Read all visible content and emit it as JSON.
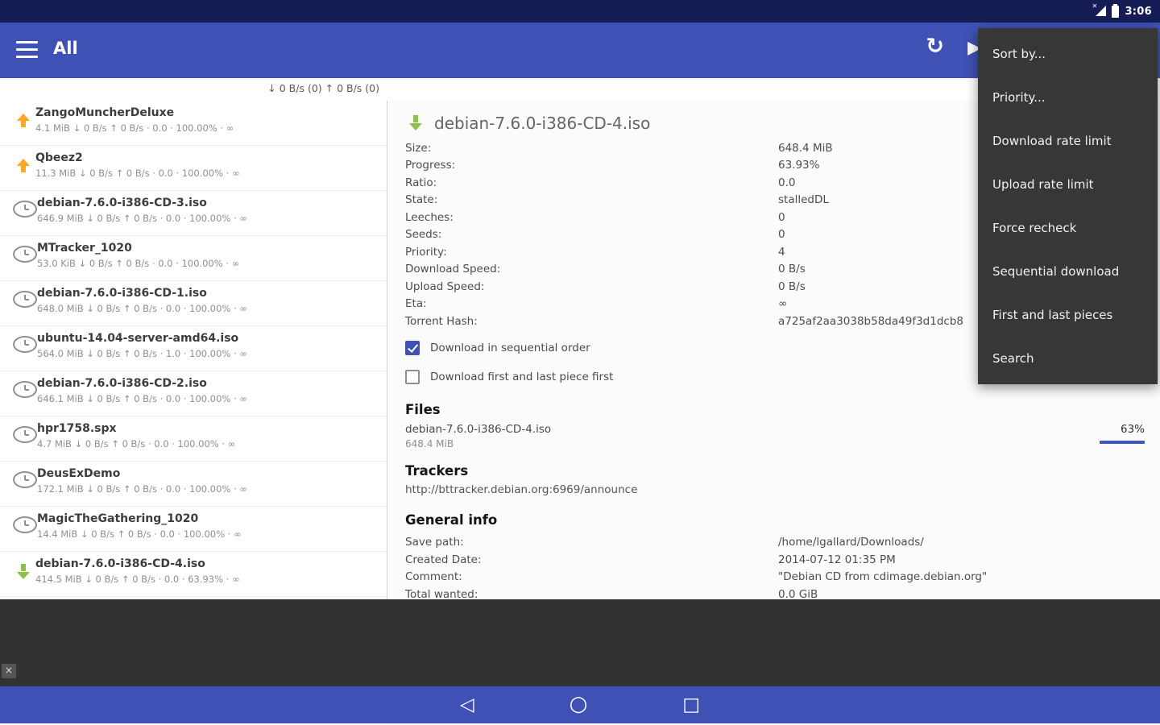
{
  "colors": {
    "primary": "#3F51B5",
    "accent_green": "#8BC34A",
    "accent_orange": "#FFA726"
  },
  "status_bar": {
    "time": "3:06"
  },
  "toolbar": {
    "title": "All"
  },
  "icons": {
    "refresh": "↻",
    "play": "▶",
    "close": "×",
    "nav_back": "◁",
    "nav_home": "○",
    "nav_recents": "□"
  },
  "speed_bar": {
    "text": "↓ 0 B/s (0)  ↑ 0 B/s (0)"
  },
  "menu": {
    "items": [
      "Sort by...",
      "Priority...",
      "Download rate limit",
      "Upload rate limit",
      "Force recheck",
      "Sequential download",
      "First and last pieces",
      "Search"
    ]
  },
  "torrents": [
    {
      "name": "ZangoMuncherDeluxe",
      "stats": "4.1 MiB ↓ 0 B/s ↑ 0 B/s · 0.0 · 100.00% · ∞",
      "icon": "upload"
    },
    {
      "name": "Qbeez2",
      "stats": "11.3 MiB ↓ 0 B/s ↑ 0 B/s · 0.0 · 100.00% · ∞",
      "icon": "upload"
    },
    {
      "name": "debian-7.6.0-i386-CD-3.iso",
      "stats": "646.9 MiB ↓ 0 B/s ↑ 0 B/s · 0.0 · 100.00% · ∞",
      "icon": "clock"
    },
    {
      "name": "MTracker_1020",
      "stats": "53.0 KiB ↓ 0 B/s ↑ 0 B/s · 0.0 · 100.00% · ∞",
      "icon": "clock"
    },
    {
      "name": "debian-7.6.0-i386-CD-1.iso",
      "stats": "648.0 MiB ↓ 0 B/s ↑ 0 B/s · 0.0 · 100.00% · ∞",
      "icon": "clock"
    },
    {
      "name": "ubuntu-14.04-server-amd64.iso",
      "stats": "564.0 MiB ↓ 0 B/s ↑ 0 B/s · 1.0 · 100.00% · ∞",
      "icon": "clock"
    },
    {
      "name": "debian-7.6.0-i386-CD-2.iso",
      "stats": "646.1 MiB ↓ 0 B/s ↑ 0 B/s · 0.0 · 100.00% · ∞",
      "icon": "clock"
    },
    {
      "name": "hpr1758.spx",
      "stats": "4.7 MiB ↓ 0 B/s ↑ 0 B/s · 0.0 · 100.00% · ∞",
      "icon": "clock"
    },
    {
      "name": "DeusExDemo",
      "stats": "172.1 MiB ↓ 0 B/s ↑ 0 B/s · 0.0 · 100.00% · ∞",
      "icon": "clock"
    },
    {
      "name": "MagicTheGathering_1020",
      "stats": "14.4 MiB ↓ 0 B/s ↑ 0 B/s · 0.0 · 100.00% · ∞",
      "icon": "clock"
    },
    {
      "name": "debian-7.6.0-i386-CD-4.iso",
      "stats": "414.5 MiB ↓ 0 B/s ↑ 0 B/s · 0.0 · 63.93% · ∞",
      "icon": "download"
    }
  ],
  "detail": {
    "title": "debian-7.6.0-i386-CD-4.iso",
    "rows": [
      {
        "label": "Size:",
        "value": "648.4 MiB"
      },
      {
        "label": "Progress:",
        "value": "63.93%"
      },
      {
        "label": "Ratio:",
        "value": "0.0"
      },
      {
        "label": "State:",
        "value": "stalledDL"
      },
      {
        "label": "Leeches:",
        "value": "0"
      },
      {
        "label": "Seeds:",
        "value": "0"
      },
      {
        "label": "Priority:",
        "value": "4"
      },
      {
        "label": "Download Speed:",
        "value": "0 B/s"
      },
      {
        "label": "Upload Speed:",
        "value": "0 B/s"
      },
      {
        "label": "Eta:",
        "value": "∞"
      },
      {
        "label": "Torrent Hash:",
        "value": "a725af2aa3038b58da49f3d1dcb8"
      }
    ],
    "checkboxes": [
      {
        "label": "Download in sequential order",
        "state": "checked"
      },
      {
        "label": "Download first and last piece first",
        "state": "unchecked"
      }
    ],
    "files": {
      "header": "Files",
      "name": "debian-7.6.0-i386-CD-4.iso",
      "size": "648.4 MiB",
      "percent": "63%"
    },
    "trackers": {
      "header": "Trackers",
      "url": "http://bttracker.debian.org:6969/announce"
    },
    "general": {
      "header": "General info",
      "rows": [
        {
          "label": "Save path:",
          "value": "/home/lgallard/Downloads/"
        },
        {
          "label": "Created Date:",
          "value": "2014-07-12 01:35 PM"
        },
        {
          "label": "Comment:",
          "value": "\"Debian CD from cdimage.debian.org\""
        },
        {
          "label": "Total wanted:",
          "value": "0.0 GiB"
        }
      ]
    }
  }
}
